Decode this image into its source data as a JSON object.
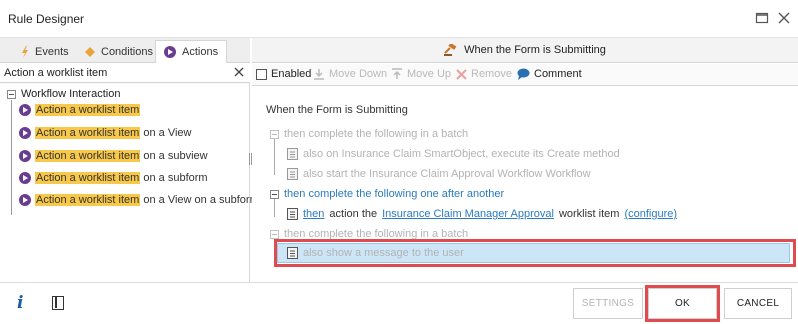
{
  "window": {
    "title": "Rule Designer"
  },
  "left_panel": {
    "tabs": [
      {
        "label": "Events",
        "icon": "lightning-icon"
      },
      {
        "label": "Conditions",
        "icon": "diamond-icon"
      },
      {
        "label": "Actions",
        "icon": "arrow-circle-icon",
        "active": true
      }
    ],
    "search": {
      "value": "Action a worklist item"
    },
    "tree": {
      "group_label": "Workflow Interaction",
      "items": [
        {
          "match": "Action a worklist item",
          "rest": ""
        },
        {
          "match": "Action a worklist item",
          "rest": " on a View"
        },
        {
          "match": "Action a worklist item",
          "rest": " on a subview"
        },
        {
          "match": "Action a worklist item",
          "rest": " on a subform"
        },
        {
          "match": "Action a worklist item",
          "rest": " on a View on a subform"
        }
      ]
    }
  },
  "right_panel": {
    "header": "When the Form is Submitting",
    "toolbar": {
      "enabled": "Enabled",
      "move_down": "Move Down",
      "move_up": "Move Up",
      "remove": "Remove",
      "comment": "Comment"
    },
    "rule": {
      "event": "When the Form is Submitting",
      "block1": "then complete the following in a batch",
      "b1_line1": "also on Insurance Claim SmartObject, execute its Create method",
      "b1_line2": "also start the Insurance Claim Approval Workflow Workflow",
      "block2": "then complete the following one after another",
      "b2_then": "then",
      "b2_action": "action the",
      "b2_link": "Insurance Claim Manager Approval",
      "b2_worklist": "worklist item",
      "b2_configure": "(configure)",
      "block3": "then complete the following in a batch",
      "b3_line1": "also show a message to the user"
    }
  },
  "footer": {
    "info": "i",
    "settings": "SETTINGS",
    "ok": "OK",
    "cancel": "CANCEL"
  },
  "colors": {
    "highlight": "#f7c84a",
    "link": "#2a7bbf",
    "selection": "#cde6f7",
    "focus_box": "#e04b50"
  }
}
